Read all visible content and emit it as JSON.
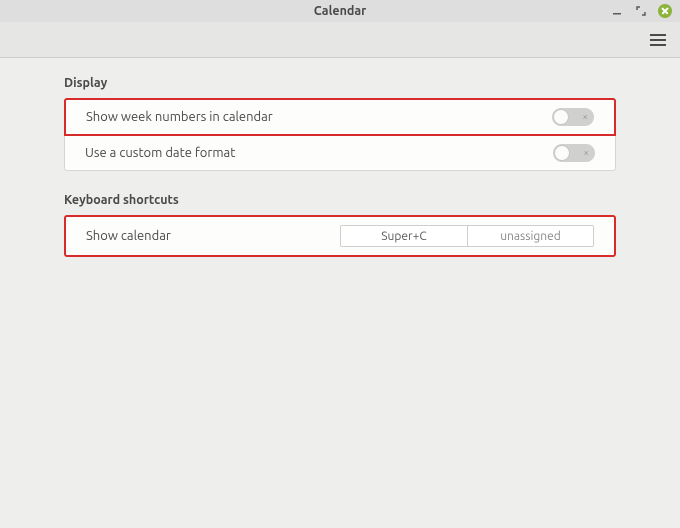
{
  "window": {
    "title": "Calendar"
  },
  "sections": {
    "display": {
      "title": "Display",
      "rows": [
        {
          "label": "Show week numbers in calendar",
          "value": false
        },
        {
          "label": "Use a custom date format",
          "value": false
        }
      ]
    },
    "keyboard": {
      "title": "Keyboard shortcuts",
      "rows": [
        {
          "label": "Show calendar",
          "primary": "Super+C",
          "secondary": "unassigned"
        }
      ]
    }
  }
}
